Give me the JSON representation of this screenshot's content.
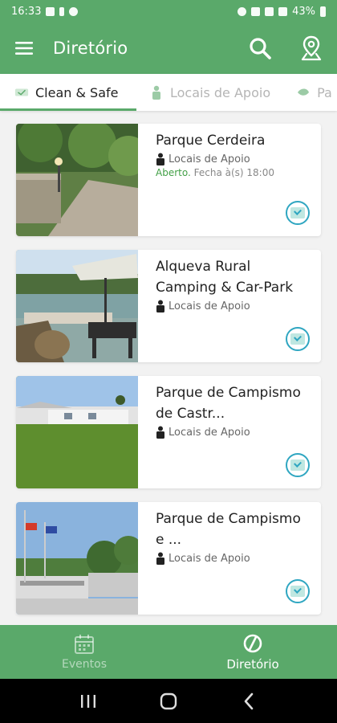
{
  "status_bar": {
    "time": "16:33",
    "battery": "43%"
  },
  "app_bar": {
    "title": "Diretório",
    "menu_icon": "hamburger-menu-icon",
    "actions": [
      "search-icon",
      "map-location-icon"
    ]
  },
  "tabs": [
    {
      "label": "Clean & Safe",
      "icon": "clean-safe-icon",
      "active": true
    },
    {
      "label": "Locais de Apoio",
      "icon": "person-icon",
      "active": false
    },
    {
      "label": "Pa",
      "icon": "leaf-icon",
      "active": false
    }
  ],
  "listings": [
    {
      "title": "Parque Cerdeira",
      "category": "Locais de Apoio",
      "status_open": "Aberto.",
      "status_rest": "Fecha à(s) 18:00",
      "badge_icon": "clean-safe-badge-icon"
    },
    {
      "title": "Alqueva Rural Camping & Car-Park",
      "category": "Locais de Apoio",
      "badge_icon": "clean-safe-badge-icon"
    },
    {
      "title": "Parque de Campismo de Castr...",
      "category": "Locais de Apoio",
      "badge_icon": "clean-safe-badge-icon"
    },
    {
      "title": "Parque de Campismo e ...",
      "category": "Locais de Apoio",
      "badge_icon": "clean-safe-badge-icon"
    }
  ],
  "bottom_nav": [
    {
      "label": "Eventos",
      "icon": "calendar-icon",
      "active": false
    },
    {
      "label": "Diretório",
      "icon": "compass-icon",
      "active": true
    }
  ],
  "colors": {
    "primary": "#5aa96a",
    "open": "#43a047",
    "badge": "#2fa6c1"
  }
}
